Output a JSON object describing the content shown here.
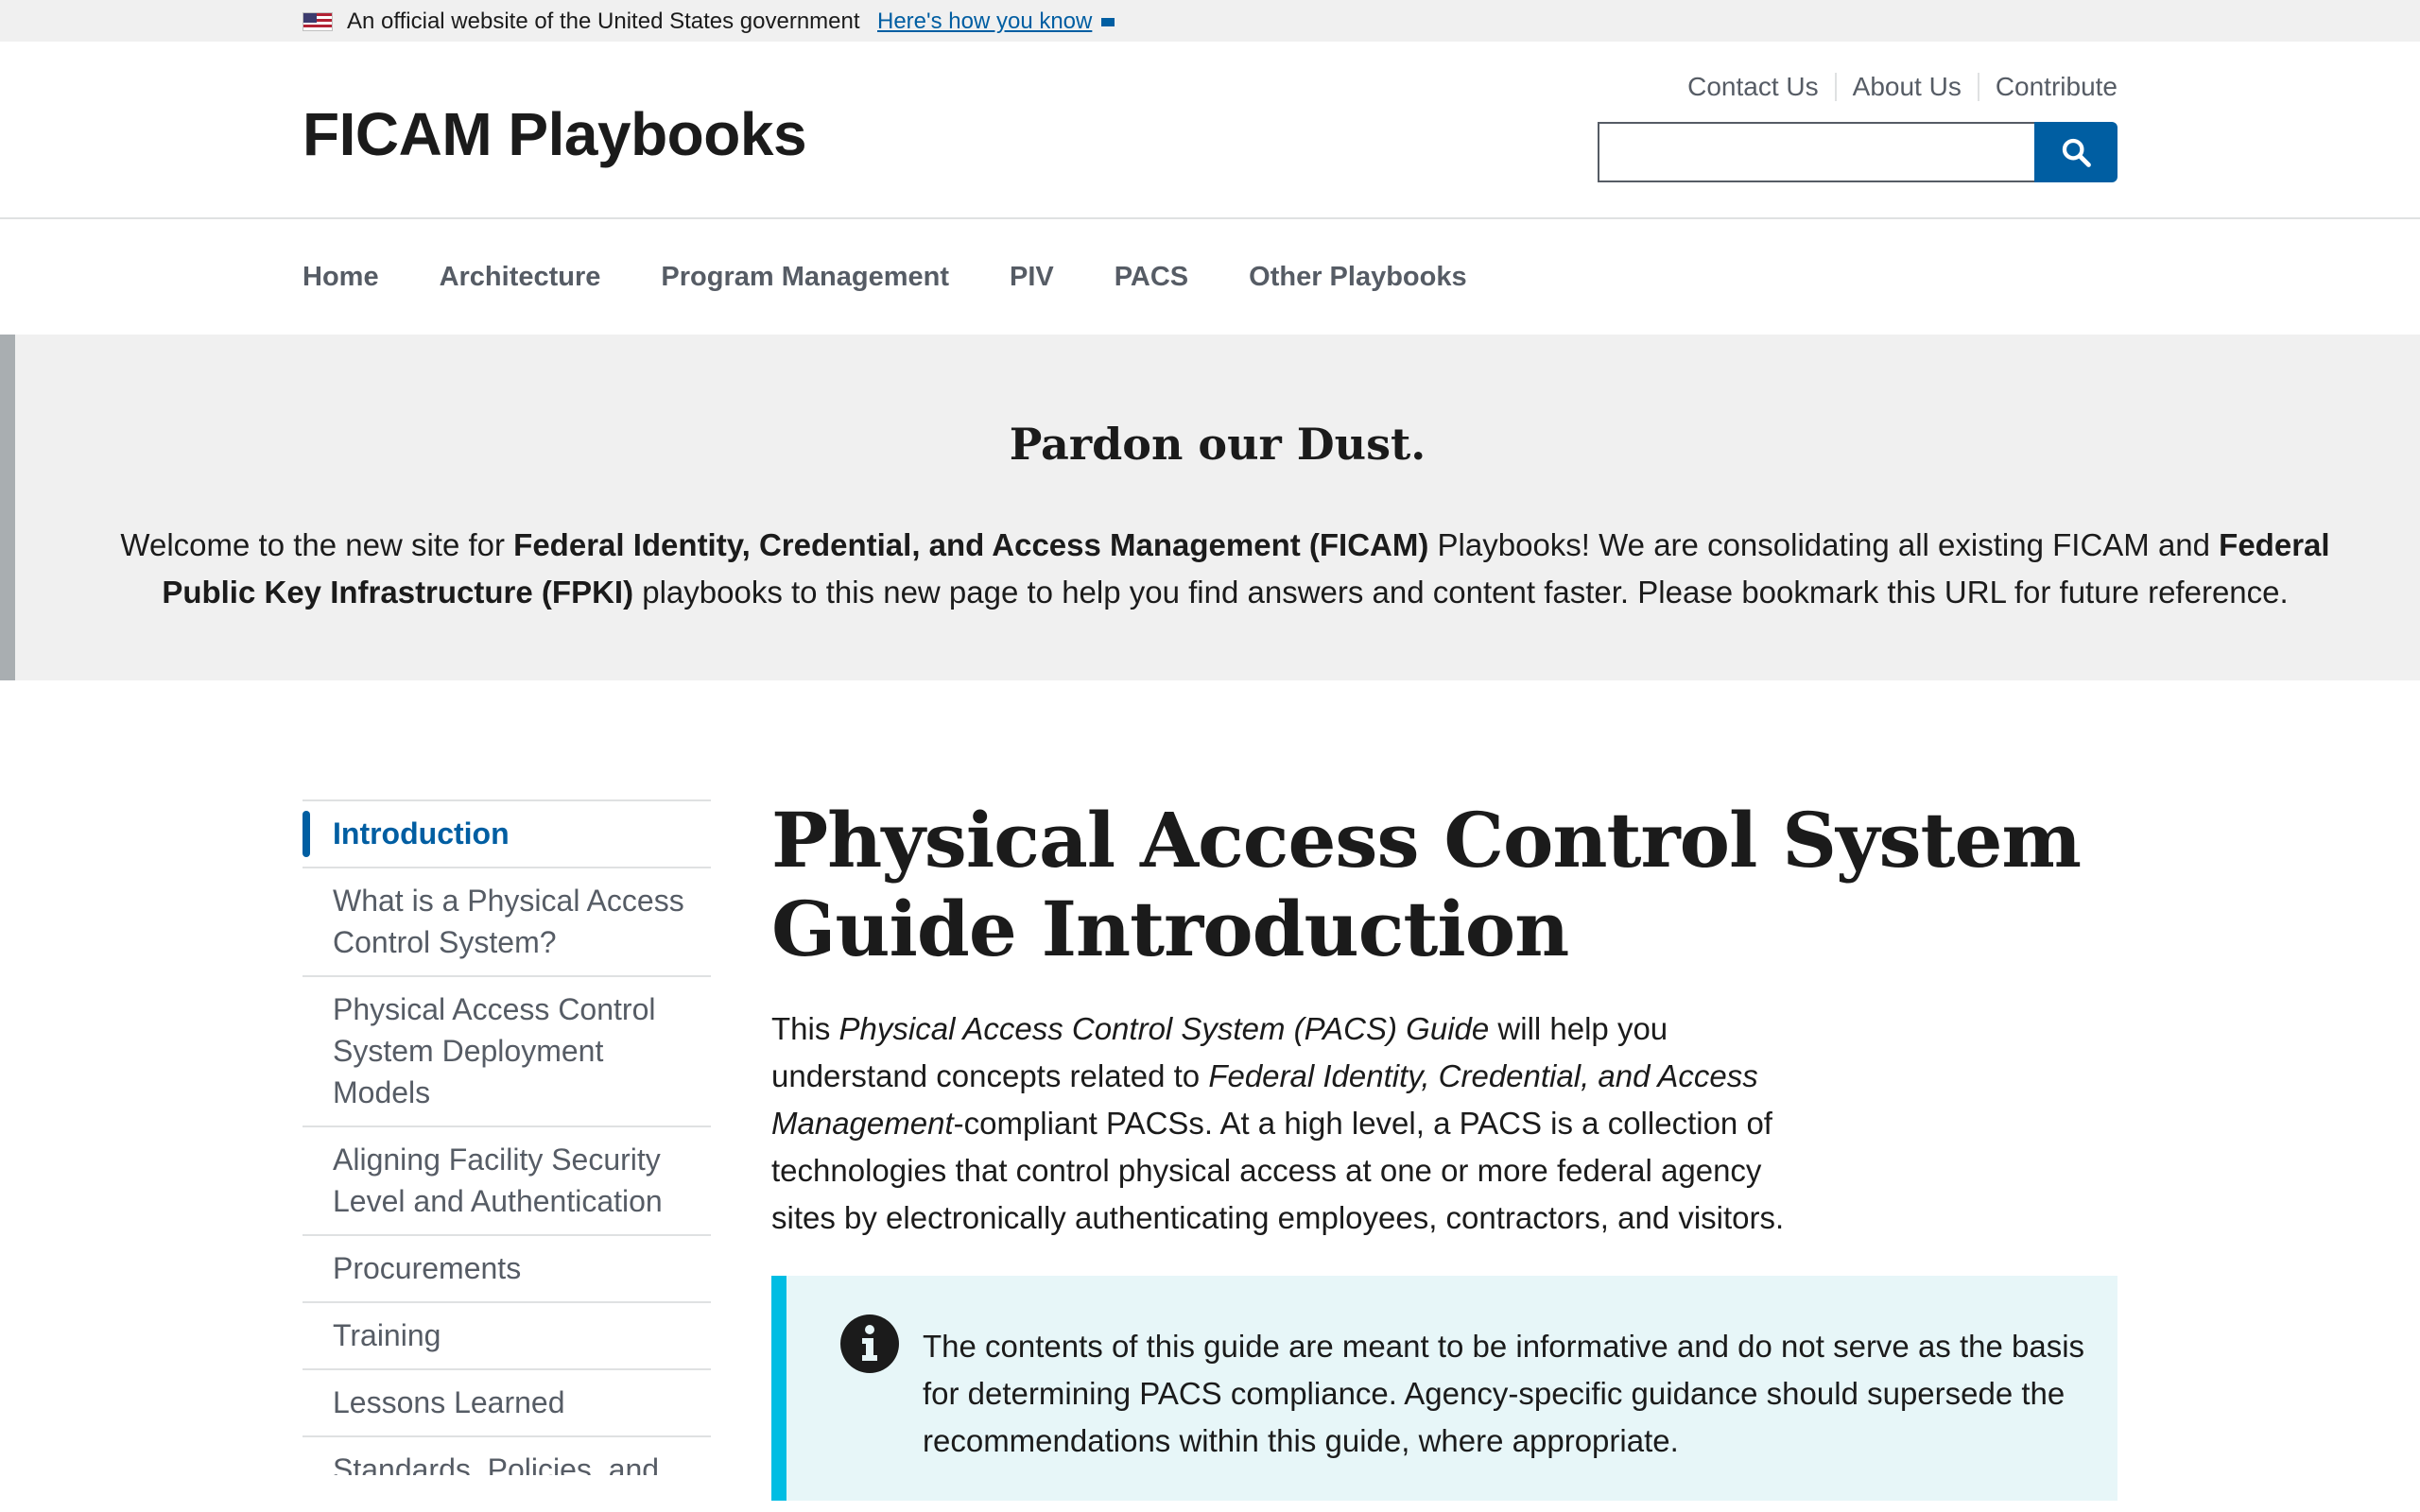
{
  "gov_banner": {
    "official_text": "An official website of the United States government",
    "how_you_know_link": "Here's how you know",
    "flag_icon": "us-flag-icon"
  },
  "header": {
    "site_title": "FICAM Playbooks",
    "secondary_links": [
      "Contact Us",
      "About Us",
      "Contribute"
    ],
    "search": {
      "value": "",
      "placeholder": "",
      "button_icon": "search-icon"
    }
  },
  "primary_nav": {
    "items": [
      "Home",
      "Architecture",
      "Program Management",
      "PIV",
      "PACS",
      "Other Playbooks"
    ]
  },
  "site_alert": {
    "heading": "Pardon our Dust.",
    "body_1": "Welcome to the new site for ",
    "bold_1": "Federal Identity, Credential, and Access Management (FICAM)",
    "body_2": " Playbooks! We are consolidating all existing FICAM and ",
    "bold_2": "Federal Public Key Infrastructure (FPKI)",
    "body_3": " playbooks to this new page to help you find answers and content faster. Please bookmark this URL for future reference."
  },
  "sidenav": {
    "items": [
      "Introduction",
      "What is a Physical Access Control System?",
      "Physical Access Control System Deployment Models",
      "Aligning Facility Security Level and Authentication",
      "Procurements",
      "Training",
      "Lessons Learned",
      "Standards, Policies, and"
    ],
    "current_index": 0
  },
  "main": {
    "title": "Physical Access Control System Guide Introduction",
    "intro": {
      "t1": "This ",
      "i1": "Physical Access Control System (PACS) Guide",
      "t2": " will help you understand concepts related to ",
      "i2": "Federal Identity, Credential, and Access Management",
      "t3": "-compliant PACSs. At a high level, a PACS is a collection of technologies that control physical access at one or more federal agency sites by electronically authenticating employees, contractors, and visitors."
    },
    "info_alert": {
      "icon": "info-icon",
      "text": "The contents of this guide are meant to be informative and do not serve as the basis for determining PACS compliance. Agency-specific guidance should supersede the recommendations within this guide, where appropriate."
    }
  },
  "colors": {
    "primary": "#005ea2",
    "info_accent": "#00bde3",
    "info_bg": "#e7f6f8",
    "alert_bg": "#f0f0f0",
    "nav_text": "#565c65"
  }
}
